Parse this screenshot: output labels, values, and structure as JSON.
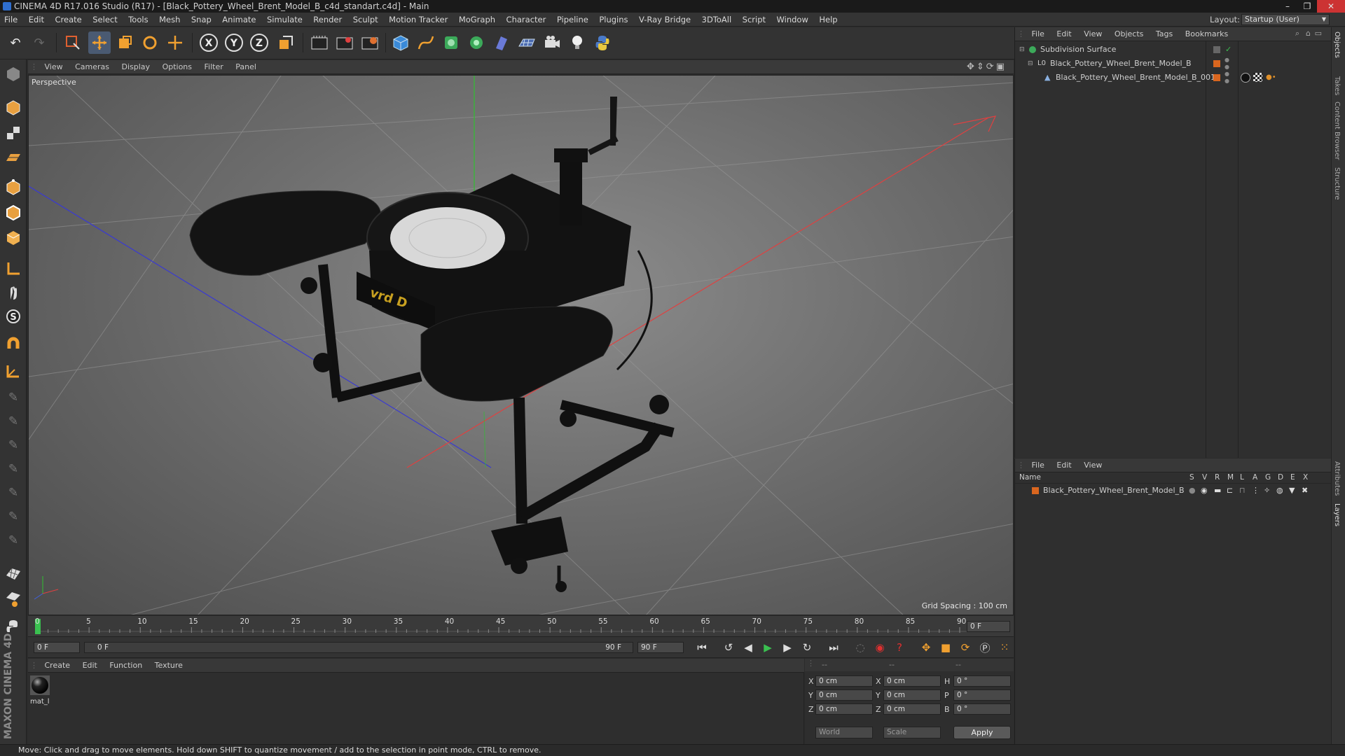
{
  "window": {
    "title": "CINEMA 4D R17.016 Studio (R17) - [Black_Pottery_Wheel_Brent_Model_B_c4d_standart.c4d] - Main"
  },
  "menubar": [
    "File",
    "Edit",
    "Create",
    "Select",
    "Tools",
    "Mesh",
    "Snap",
    "Animate",
    "Simulate",
    "Render",
    "Sculpt",
    "Motion Tracker",
    "MoGraph",
    "Character",
    "Pipeline",
    "Plugins",
    "V-Ray Bridge",
    "3DToAll",
    "Script",
    "Window",
    "Help"
  ],
  "layout": {
    "label": "Layout:",
    "value": "Startup (User)"
  },
  "viewport": {
    "menu": [
      "View",
      "Cameras",
      "Display",
      "Options",
      "Filter",
      "Panel"
    ],
    "label": "Perspective",
    "grid_spacing": "Grid Spacing : 100 cm",
    "object_badge": "vrd D"
  },
  "timeline": {
    "ticks": [
      "0",
      "5",
      "10",
      "15",
      "20",
      "25",
      "30",
      "35",
      "40",
      "45",
      "50",
      "55",
      "60",
      "65",
      "70",
      "75",
      "80",
      "85",
      "90"
    ],
    "current_frame": "0 F",
    "start_field": "0 F",
    "range_start": "0 F",
    "range_end": "90 F",
    "end_field": "90 F"
  },
  "material_manager": {
    "menu": [
      "Create",
      "Edit",
      "Function",
      "Texture"
    ],
    "materials": [
      {
        "name": "mat_l"
      }
    ]
  },
  "coordinates": {
    "header": [
      "--",
      "--",
      "--"
    ],
    "rows": [
      {
        "axis": "X",
        "pos": "0 cm",
        "axis2": "X",
        "size": "0 cm",
        "rot_axis": "H",
        "rot": "0 °"
      },
      {
        "axis": "Y",
        "pos": "0 cm",
        "axis2": "Y",
        "size": "0 cm",
        "rot_axis": "P",
        "rot": "0 °"
      },
      {
        "axis": "Z",
        "pos": "0 cm",
        "axis2": "Z",
        "size": "0 cm",
        "rot_axis": "B",
        "rot": "0 °"
      }
    ],
    "mode": "World",
    "scale_mode": "Scale",
    "apply": "Apply"
  },
  "object_manager": {
    "menu": [
      "File",
      "Edit",
      "View",
      "Objects",
      "Tags",
      "Bookmarks"
    ],
    "objects": [
      {
        "name": "Subdivision Surface"
      },
      {
        "name": "Black_Pottery_Wheel_Brent_Model_B"
      },
      {
        "name": "Black_Pottery_Wheel_Brent_Model_B_001"
      }
    ]
  },
  "layer_manager": {
    "menu": [
      "File",
      "Edit",
      "View"
    ],
    "columns": [
      "Name",
      "S",
      "V",
      "R",
      "M",
      "L",
      "A",
      "G",
      "D",
      "E",
      "X"
    ],
    "layers": [
      {
        "name": "Black_Pottery_Wheel_Brent_Model_B"
      }
    ]
  },
  "right_tabs": [
    "Objects",
    "Takes",
    "Content Browser",
    "Structure",
    "Attributes",
    "Layers"
  ],
  "brand": "MAXON CINEMA 4D",
  "status": "Move: Click and drag to move elements. Hold down SHIFT to quantize movement / add to the selection in point mode, CTRL to remove."
}
